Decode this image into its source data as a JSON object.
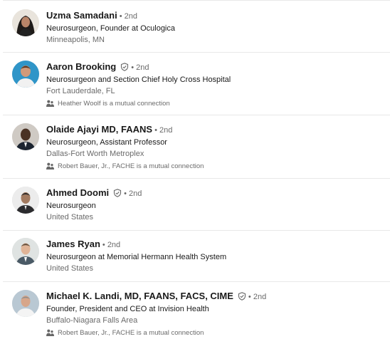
{
  "people": [
    {
      "name": "Uzma Samadani",
      "verified": false,
      "degree": "2nd",
      "headline": "Neurosurgeon, Founder at Oculogica",
      "location": "Minneapolis, MN",
      "mutual": ""
    },
    {
      "name": "Aaron Brooking",
      "verified": true,
      "degree": "2nd",
      "headline": "Neurosurgeon and Section Chief Holy Cross Hospital",
      "location": "Fort Lauderdale, FL",
      "mutual": "Heather Woolf is a mutual connection"
    },
    {
      "name": "Olaide Ajayi MD, FAANS",
      "verified": false,
      "degree": "2nd",
      "headline": "Neurosurgeon, Assistant Professor",
      "location": "Dallas-Fort Worth Metroplex",
      "mutual": "Robert Bauer, Jr., FACHE is a mutual connection"
    },
    {
      "name": "Ahmed Doomi",
      "verified": true,
      "degree": "2nd",
      "headline": "Neurosurgeon",
      "location": "United States",
      "mutual": ""
    },
    {
      "name": "James Ryan",
      "verified": false,
      "degree": "2nd",
      "headline": "Neurosurgeon at Memorial Hermann Health System",
      "location": "United States",
      "mutual": ""
    },
    {
      "name": "Michael K. Landi, MD, FAANS, FACS, CIME",
      "verified": true,
      "degree": "2nd",
      "headline": "Founder, President and CEO at Invision Health",
      "location": "Buffalo-Niagara Falls Area",
      "mutual": "Robert Bauer, Jr., FACHE is a mutual connection"
    }
  ],
  "colors": {
    "text": "#191919",
    "secondary": "#666666",
    "divider": "#e8e8e8"
  }
}
